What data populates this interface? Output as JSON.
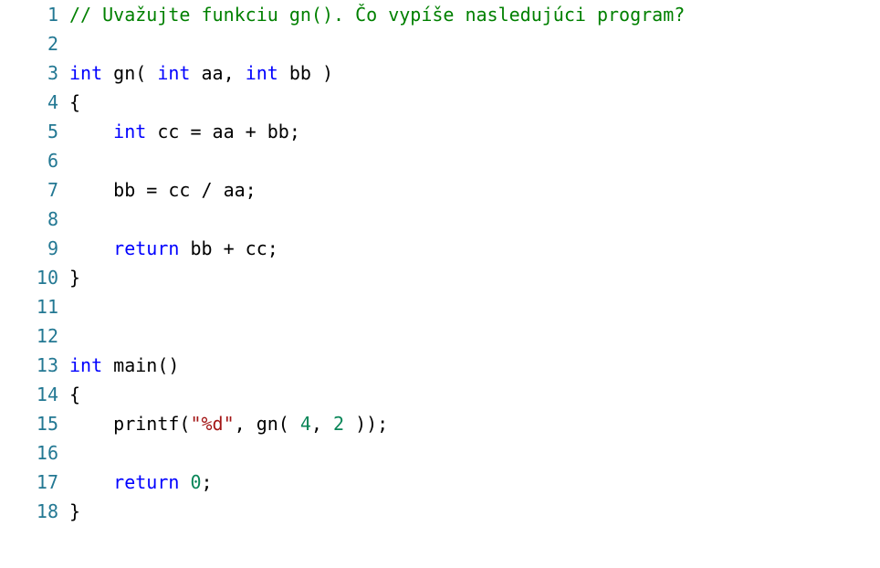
{
  "editor": {
    "colors": {
      "line_number": "#237893",
      "comment": "#008000",
      "keyword": "#0000ff",
      "string": "#a31515",
      "number": "#098658",
      "plain": "#000000",
      "background": "#ffffff"
    },
    "lines": [
      {
        "number": "1",
        "tokens": [
          {
            "type": "comment",
            "text": "// Uvažujte funkciu gn(). Čo vypíše nasledujúci program?"
          }
        ]
      },
      {
        "number": "2",
        "tokens": []
      },
      {
        "number": "3",
        "tokens": [
          {
            "type": "keyword",
            "text": "int"
          },
          {
            "type": "plain",
            "text": " gn( "
          },
          {
            "type": "keyword",
            "text": "int"
          },
          {
            "type": "plain",
            "text": " aa, "
          },
          {
            "type": "keyword",
            "text": "int"
          },
          {
            "type": "plain",
            "text": " bb )"
          }
        ]
      },
      {
        "number": "4",
        "tokens": [
          {
            "type": "plain",
            "text": "{"
          }
        ]
      },
      {
        "number": "5",
        "tokens": [
          {
            "type": "plain",
            "text": "    "
          },
          {
            "type": "keyword",
            "text": "int"
          },
          {
            "type": "plain",
            "text": " cc = aa + bb;"
          }
        ]
      },
      {
        "number": "6",
        "tokens": []
      },
      {
        "number": "7",
        "tokens": [
          {
            "type": "plain",
            "text": "    bb = cc / aa;"
          }
        ]
      },
      {
        "number": "8",
        "tokens": []
      },
      {
        "number": "9",
        "tokens": [
          {
            "type": "plain",
            "text": "    "
          },
          {
            "type": "keyword",
            "text": "return"
          },
          {
            "type": "plain",
            "text": " bb + cc;"
          }
        ]
      },
      {
        "number": "10",
        "tokens": [
          {
            "type": "plain",
            "text": "}"
          }
        ]
      },
      {
        "number": "11",
        "tokens": []
      },
      {
        "number": "12",
        "tokens": []
      },
      {
        "number": "13",
        "tokens": [
          {
            "type": "keyword",
            "text": "int"
          },
          {
            "type": "plain",
            "text": " main()"
          }
        ]
      },
      {
        "number": "14",
        "tokens": [
          {
            "type": "plain",
            "text": "{"
          }
        ]
      },
      {
        "number": "15",
        "tokens": [
          {
            "type": "plain",
            "text": "    printf("
          },
          {
            "type": "string",
            "text": "\"%d\""
          },
          {
            "type": "plain",
            "text": ", gn( "
          },
          {
            "type": "number",
            "text": "4"
          },
          {
            "type": "plain",
            "text": ", "
          },
          {
            "type": "number",
            "text": "2"
          },
          {
            "type": "plain",
            "text": " ));"
          }
        ]
      },
      {
        "number": "16",
        "tokens": []
      },
      {
        "number": "17",
        "tokens": [
          {
            "type": "plain",
            "text": "    "
          },
          {
            "type": "keyword",
            "text": "return"
          },
          {
            "type": "plain",
            "text": " "
          },
          {
            "type": "number",
            "text": "0"
          },
          {
            "type": "plain",
            "text": ";"
          }
        ]
      },
      {
        "number": "18",
        "tokens": [
          {
            "type": "plain",
            "text": "}"
          }
        ]
      }
    ]
  }
}
